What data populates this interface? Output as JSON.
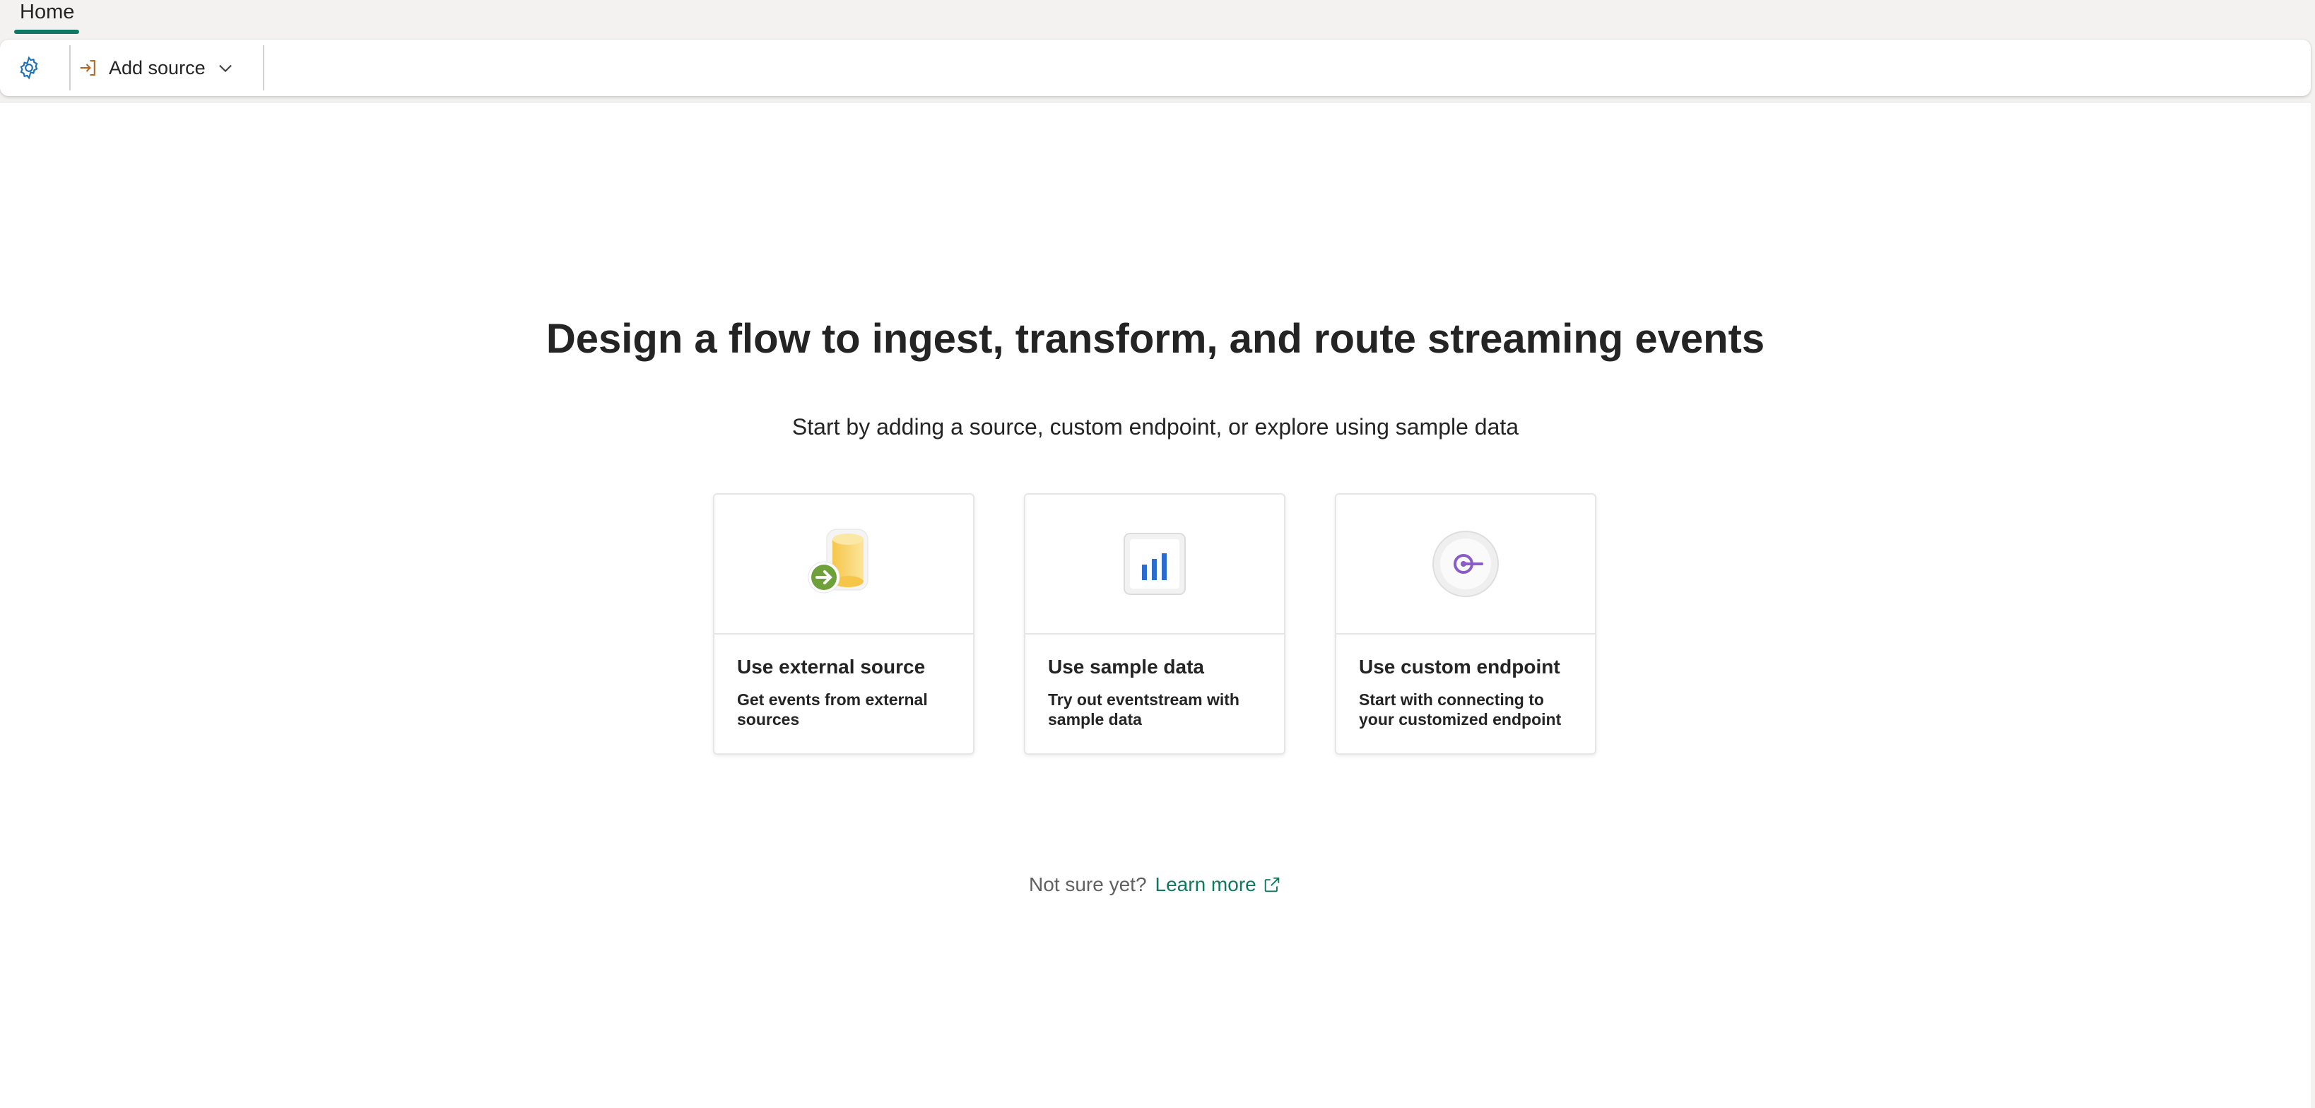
{
  "tabs": {
    "home_label": "Home"
  },
  "toolbar": {
    "settings_icon": "gear-icon",
    "add_source_icon": "sign-in-icon",
    "add_source_label": "Add source",
    "add_source_chevron": "chevron-down-icon"
  },
  "main": {
    "headline": "Design a flow to ingest, transform, and route streaming events",
    "subline": "Start by adding a source, custom endpoint, or explore using sample data",
    "cards": [
      {
        "title": "Use external source",
        "description": "Get events from external sources",
        "icon": "database-arrow-icon"
      },
      {
        "title": "Use sample data",
        "description": "Try out eventstream with sample data",
        "icon": "bar-chart-icon"
      },
      {
        "title": "Use custom endpoint",
        "description": "Start with connecting to your customized endpoint",
        "icon": "endpoint-icon"
      }
    ],
    "footer": {
      "not_sure": "Not sure yet?",
      "learn_more": "Learn more",
      "learn_more_icon": "external-link-icon"
    }
  },
  "colors": {
    "accent": "#117865",
    "link": "#0e7a5f",
    "settings_icon": "#1f6fb5",
    "add_source_icon": "#b5651d"
  }
}
